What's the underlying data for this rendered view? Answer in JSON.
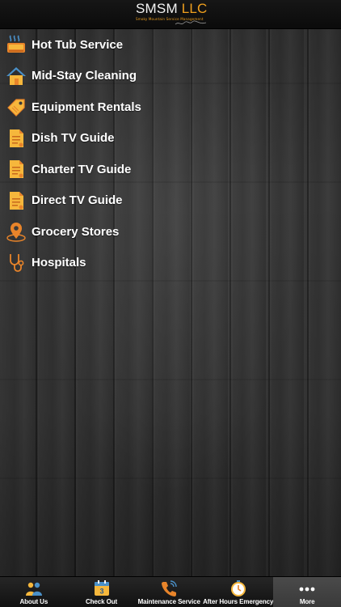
{
  "header": {
    "logo_main": "SMSM",
    "logo_llc": "LLC",
    "logo_sub": "Smoky Mountain Service Management"
  },
  "menu": {
    "items": [
      {
        "label": "Hot Tub Service",
        "icon": "hot-tub-icon"
      },
      {
        "label": "Mid-Stay Cleaning",
        "icon": "house-icon"
      },
      {
        "label": "Equipment Rentals",
        "icon": "price-tag-icon"
      },
      {
        "label": "Dish TV Guide",
        "icon": "document-icon"
      },
      {
        "label": "Charter TV Guide",
        "icon": "document-icon"
      },
      {
        "label": "Direct TV Guide",
        "icon": "document-icon"
      },
      {
        "label": "Grocery Stores",
        "icon": "map-pin-icon"
      },
      {
        "label": "Hospitals",
        "icon": "stethoscope-icon"
      }
    ]
  },
  "tabbar": {
    "tabs": [
      {
        "label": "About Us",
        "icon": "people-icon"
      },
      {
        "label": "Check Out",
        "icon": "calendar-icon",
        "calendar_number": "3"
      },
      {
        "label": "Maintenance Service",
        "icon": "phone-icon"
      },
      {
        "label": "After Hours Emergency",
        "icon": "clock-icon"
      },
      {
        "label": "More",
        "icon": "more-dots-icon",
        "active": true
      }
    ]
  },
  "colors": {
    "accent": "#f0a01e",
    "icon_orange": "#e8842a",
    "icon_yellow": "#f6b73c",
    "icon_blue": "#4a90c8",
    "text": "#ffffff"
  }
}
